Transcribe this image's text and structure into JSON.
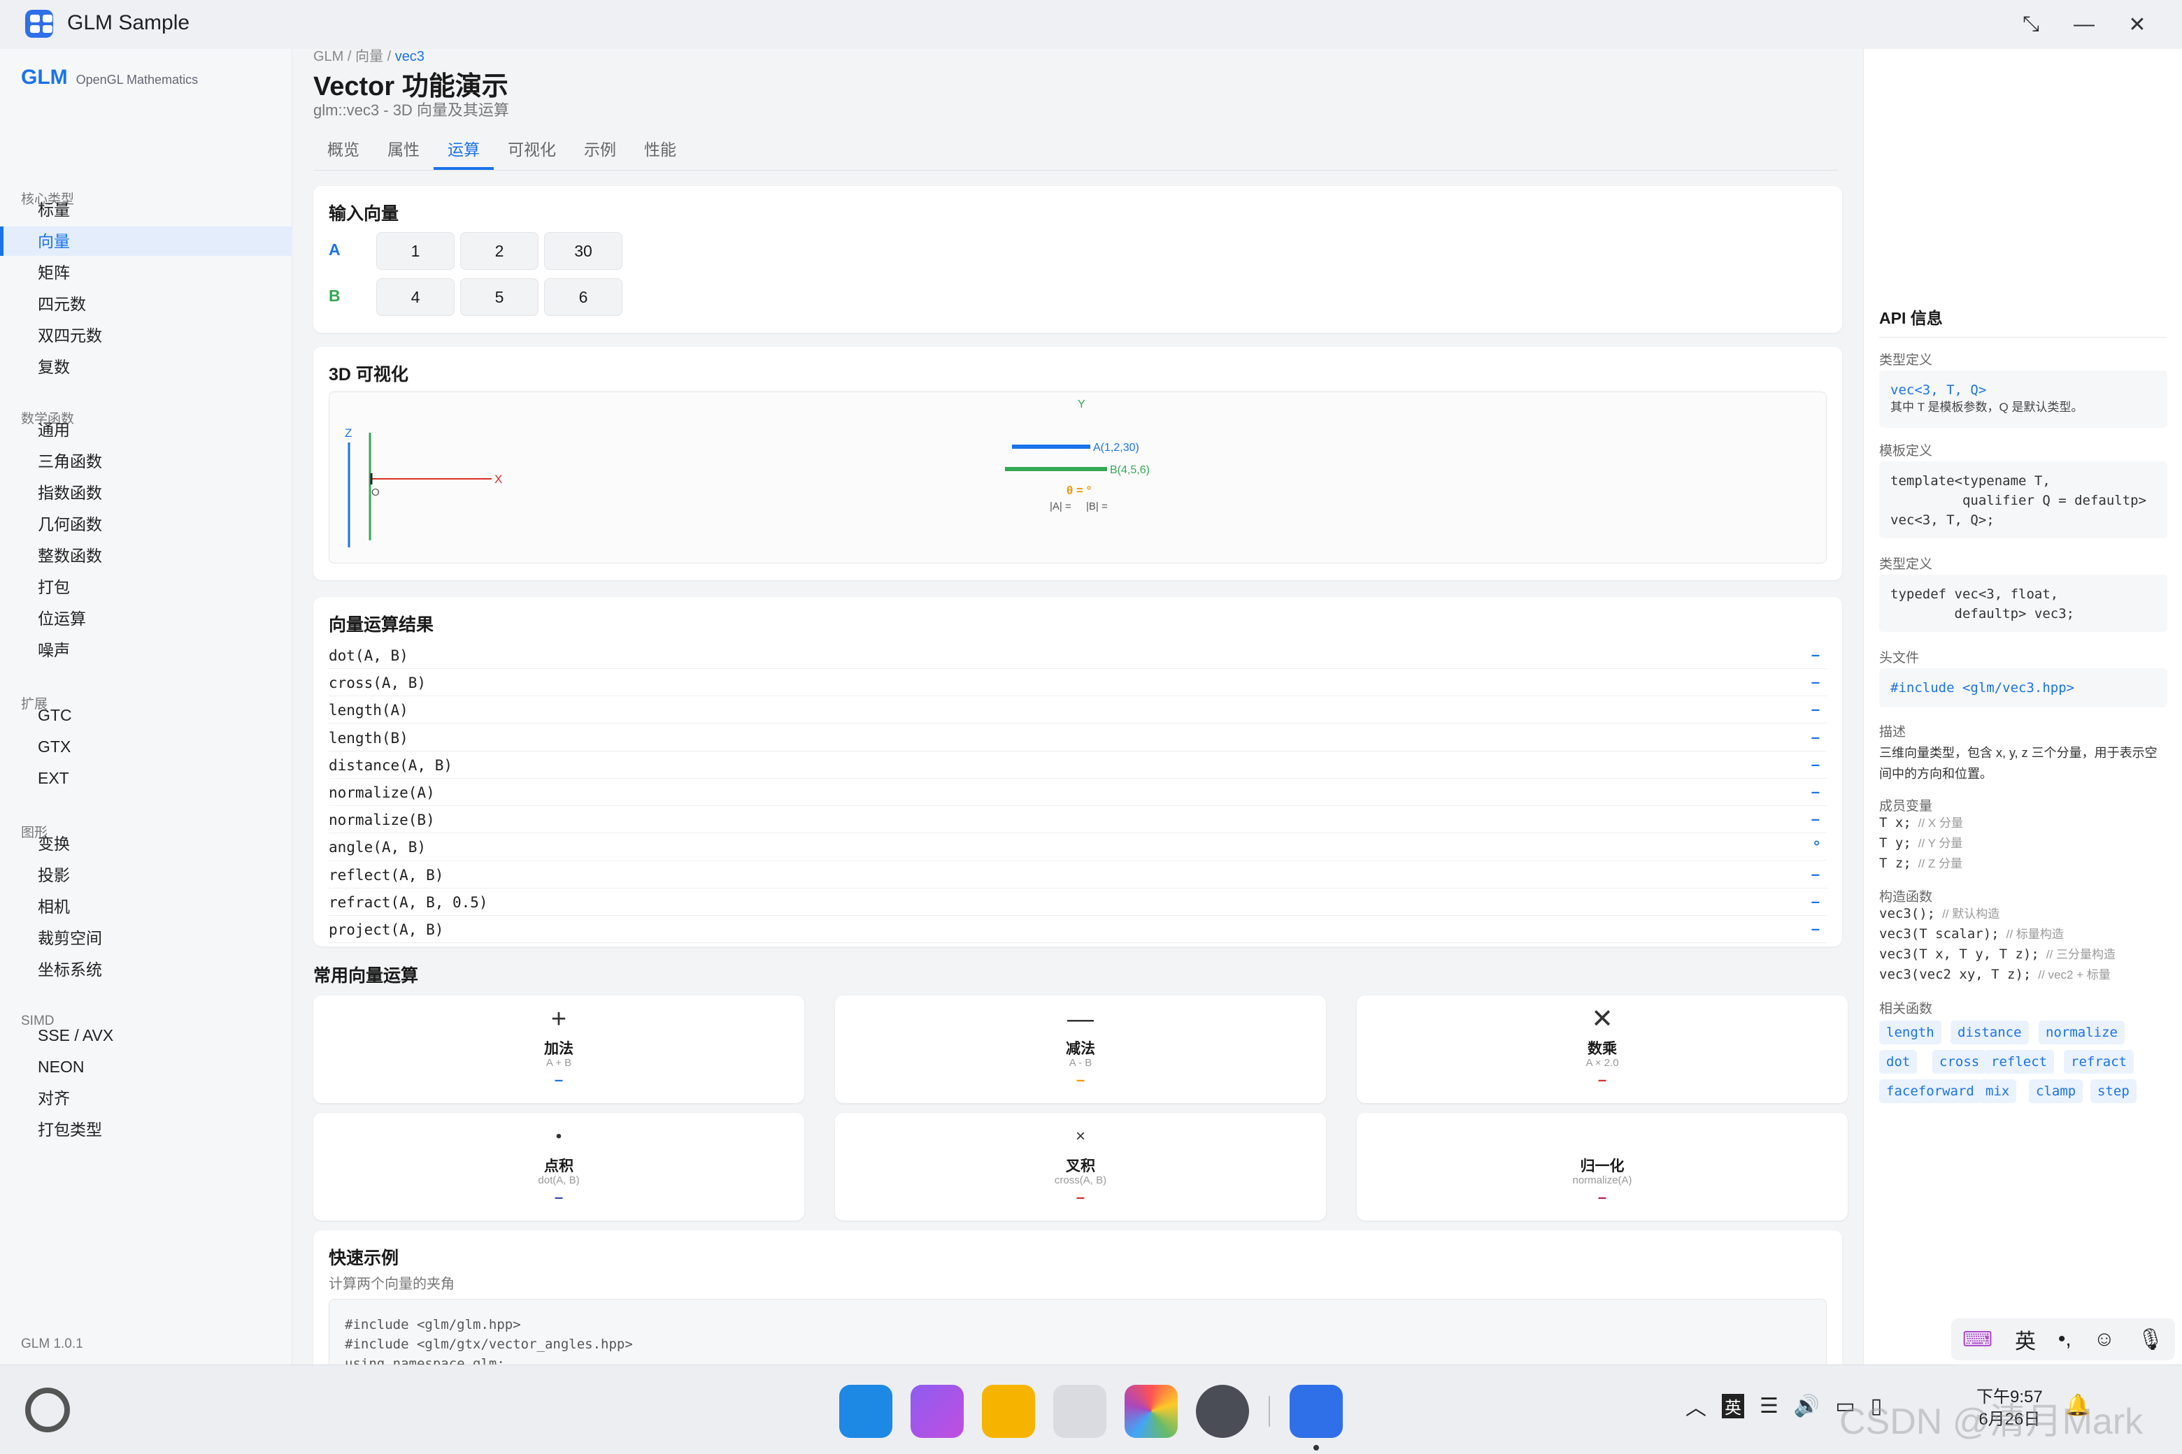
{
  "window": {
    "title": "GLM Sample",
    "restore_icon": "shrink-icon",
    "minimize_icon": "minimize-icon",
    "close_icon": "close-icon"
  },
  "sidebar": {
    "brand": "GLM",
    "brand_sub": "OpenGL Mathematics",
    "groups": [
      {
        "label": "核心类型",
        "items": [
          "标量",
          "向量",
          "矩阵",
          "四元数",
          "双四元数",
          "复数"
        ]
      },
      {
        "label": "数学函数",
        "items": [
          "通用",
          "三角函数",
          "指数函数",
          "几何函数",
          "整数函数",
          "打包",
          "位运算",
          "噪声"
        ]
      },
      {
        "label": "扩展",
        "items": [
          "GTC",
          "GTX",
          "EXT"
        ]
      },
      {
        "label": "图形",
        "items": [
          "变换",
          "投影",
          "相机",
          "裁剪空间",
          "坐标系统"
        ]
      },
      {
        "label": "SIMD",
        "items": [
          "SSE / AVX",
          "NEON",
          "对齐",
          "打包类型"
        ]
      }
    ],
    "active_item": "向量",
    "version": "GLM 1.0.1"
  },
  "main": {
    "breadcrumb": {
      "part1": "GLM / 向量 / ",
      "current": "vec3"
    },
    "title": "Vector 功能演示",
    "subtitle": "glm::vec3 - 3D 向量及其运算",
    "tabs": [
      "概览",
      "属性",
      "运算",
      "可视化",
      "示例",
      "性能"
    ],
    "active_tab": "运算",
    "input": {
      "title": "输入向量",
      "a_label": "A",
      "b_label": "B",
      "a": [
        "1",
        "2",
        "30"
      ],
      "b": [
        "4",
        "5",
        "6"
      ]
    },
    "viz": {
      "title": "3D 可视化",
      "axis_x": "X",
      "axis_y": "Y",
      "axis_z": "Z",
      "origin": "O",
      "label_a": "A(1,2,30)",
      "label_b": "B(4,5,6)",
      "theta": "θ = °",
      "mag_a": "|A| =",
      "mag_b": "|B| ="
    },
    "results": {
      "title": "向量运算结果",
      "rows": [
        {
          "name": "dot(A, B)",
          "value": "–"
        },
        {
          "name": "cross(A, B)",
          "value": "–"
        },
        {
          "name": "length(A)",
          "value": "–"
        },
        {
          "name": "length(B)",
          "value": "–"
        },
        {
          "name": "distance(A, B)",
          "value": "–"
        },
        {
          "name": "normalize(A)",
          "value": "–"
        },
        {
          "name": "normalize(B)",
          "value": "–"
        },
        {
          "name": "angle(A, B)",
          "value": "°"
        },
        {
          "name": "reflect(A, B)",
          "value": "–"
        },
        {
          "name": "refract(A, B, 0.5)",
          "value": "–"
        },
        {
          "name": "project(A, B)",
          "value": "–"
        }
      ]
    },
    "common": {
      "title": "常用向量运算",
      "ops": [
        {
          "icon": "+",
          "name": "加法",
          "formula": "A + B",
          "mark": "–",
          "color": "#1a73e8"
        },
        {
          "icon": "—",
          "name": "减法",
          "formula": "A - B",
          "mark": "–",
          "color": "#f29900"
        },
        {
          "icon": "✕",
          "name": "数乘",
          "formula": "A × 2.0",
          "mark": "–",
          "color": "#d93025"
        },
        {
          "icon": "•",
          "name": "点积",
          "formula": "dot(A, B)",
          "mark": "–",
          "color": "#3949ab"
        },
        {
          "icon": "×",
          "name": "叉积",
          "formula": "cross(A, B)",
          "mark": "–",
          "color": "#d93025"
        },
        {
          "icon": "",
          "name": "归一化",
          "formula": "normalize(A)",
          "mark": "–",
          "color": "#c2185b"
        }
      ]
    },
    "quick": {
      "title": "快速示例",
      "subtitle": "计算两个向量的夹角",
      "code": [
        "#include <glm/glm.hpp>",
        "#include <glm/gtx/vector_angles.hpp>",
        "using namespace glm;"
      ]
    }
  },
  "api": {
    "title": "API 信息",
    "type_def_label": "类型定义",
    "type_def_code": "vec<3, T, Q>",
    "type_def_desc": "其中 T 是模板参数，Q 是默认类型。",
    "template_label": "模板定义",
    "template_code": "template<typename T,\n         qualifier Q = defaultp>\nvec<3, T, Q>;",
    "typedef_label": "类型定义",
    "typedef_code": "typedef vec<3, float,\n        defaultp> vec3;",
    "header_label": "头文件",
    "header_code": "#include <glm/vec3.hpp>",
    "desc_label": "描述",
    "desc_text": "三维向量类型，包含 x, y, z 三个分量，用于表示空间中的方向和位置。",
    "members_label": "成员变量",
    "members": [
      {
        "code": "T x;",
        "comment": "// X 分量"
      },
      {
        "code": "T y;",
        "comment": "// Y 分量"
      },
      {
        "code": "T z;",
        "comment": "// Z 分量"
      }
    ],
    "ctor_label": "构造函数",
    "ctors": [
      {
        "code": "vec3();",
        "comment": "// 默认构造"
      },
      {
        "code": "vec3(T scalar);",
        "comment": "// 标量构造"
      },
      {
        "code": "vec3(T x, T y, T z);",
        "comment": "// 三分量构造"
      },
      {
        "code": "vec3(vec2 xy, T z);",
        "comment": "// vec2 + 标量"
      }
    ],
    "related_label": "相关函数",
    "related": [
      "length",
      "distance",
      "normalize",
      "dot",
      "cross",
      "reflect",
      "refract",
      "faceforward",
      "mix",
      "clamp",
      "step"
    ]
  },
  "ime": {
    "items": [
      "ime-settings-icon",
      "英",
      "punctuation-icon",
      "emoji-icon",
      "mic-icon"
    ],
    "lang": "英"
  },
  "taskbar": {
    "apps": [
      "launcher-grid-app",
      "multitask-app",
      "files-app",
      "trash-app",
      "photos-app",
      "settings-app",
      "glm-sample-app"
    ],
    "tray_lang": "英",
    "clock_time": "下午9:57",
    "clock_date": "6月26日",
    "watermark": "CSDN @清月Mark"
  },
  "colors": {
    "accent": "#1a73e8",
    "vec_a": "#1a73e8",
    "vec_b": "#34a853",
    "axis_x": "#d93025",
    "angle": "#f29900"
  }
}
